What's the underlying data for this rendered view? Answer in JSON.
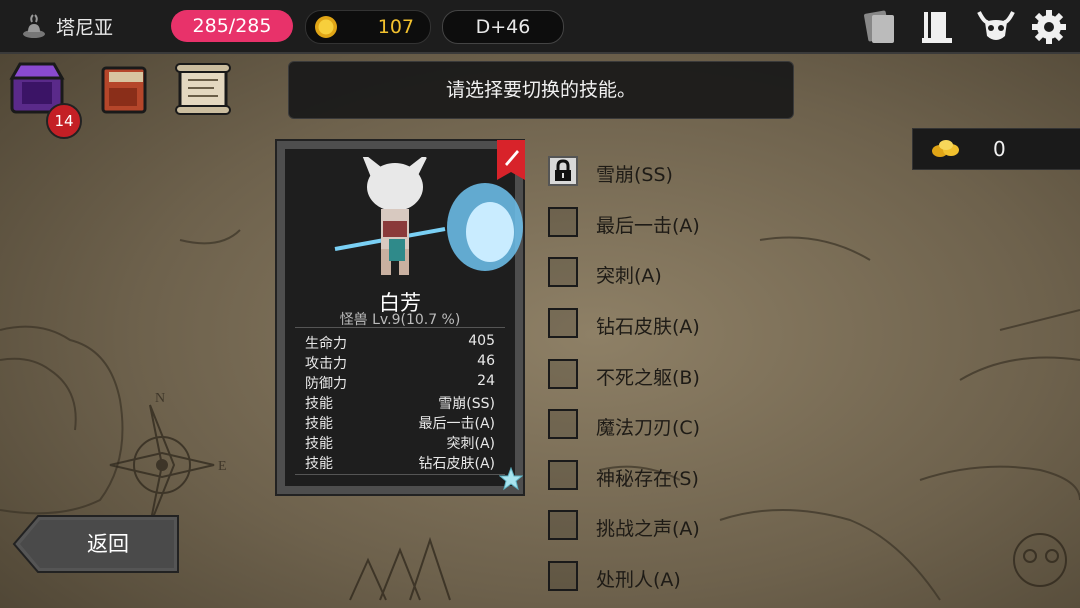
{
  "topbar": {
    "location_icon": "town-icon",
    "location_name": "塔尼亚",
    "hp": "285/285",
    "gold_icon": "gold-coin-icon",
    "gold": "107",
    "day": "D+46",
    "icons": [
      "cards-icon",
      "scroll-book-icon",
      "demon-skull-icon",
      "gear-icon"
    ]
  },
  "left_icons": {
    "chest_icon": "magic-chest-icon",
    "chest_badge": "14",
    "book_icon": "red-book-icon",
    "scroll_icon": "scroll-icon"
  },
  "prompt": "请选择要切换的技能。",
  "resource": {
    "icon": "gold-nugget-icon",
    "value": "0"
  },
  "character": {
    "name": "白芳",
    "level": "怪兽 Lv.9(10.7 %)",
    "stats": [
      {
        "key": "生命力",
        "value": "405"
      },
      {
        "key": "攻击力",
        "value": "46"
      },
      {
        "key": "防御力",
        "value": "24"
      },
      {
        "key": "技能",
        "value": "雪崩(SS)"
      },
      {
        "key": "技能",
        "value": "最后一击(A)"
      },
      {
        "key": "技能",
        "value": "突刺(A)"
      },
      {
        "key": "技能",
        "value": "钻石皮肤(A)"
      }
    ],
    "edit_icon": "edit-pencil-icon",
    "star_icon": "crystal-star-icon"
  },
  "skills": [
    {
      "label": "雪崩(SS)",
      "locked": true
    },
    {
      "label": "最后一击(A)",
      "locked": false
    },
    {
      "label": "突刺(A)",
      "locked": false
    },
    {
      "label": "钻石皮肤(A)",
      "locked": false
    },
    {
      "label": "不死之躯(B)",
      "locked": false
    },
    {
      "label": "魔法刀刃(C)",
      "locked": false
    },
    {
      "label": "神秘存在(S)",
      "locked": false
    },
    {
      "label": "挑战之声(A)",
      "locked": false
    },
    {
      "label": "处刑人(A)",
      "locked": false
    }
  ],
  "back_button": "返回",
  "colors": {
    "hp": "#e8326a",
    "gold": "#f2c12e",
    "panel": "#1e1e1e"
  }
}
